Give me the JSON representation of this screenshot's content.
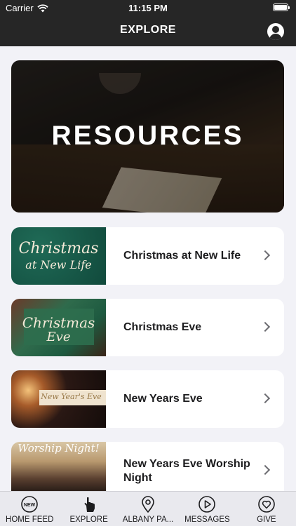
{
  "status_bar": {
    "carrier": "Carrier",
    "time": "11:15 PM"
  },
  "header": {
    "title": "EXPLORE",
    "profile_icon": "person-circle-icon"
  },
  "hero": {
    "label": "RESOURCES"
  },
  "items": [
    {
      "title": "Christmas at New Life",
      "thumb_text_1": "Christmas",
      "thumb_text_2": "at New Life"
    },
    {
      "title": "Christmas Eve",
      "thumb_text_1": "Christmas",
      "thumb_text_2": "Eve"
    },
    {
      "title": "New Years Eve",
      "thumb_text_1": "New Year's Eve"
    },
    {
      "title": "New Years Eve Worship Night",
      "thumb_text_1": "Worship Night!"
    }
  ],
  "tabs": [
    {
      "label": "HOME FEED",
      "icon": "new-badge-icon",
      "icon_text": "NEW"
    },
    {
      "label": "EXPLORE",
      "icon": "hand-pointer-icon"
    },
    {
      "label": "ALBANY PA...",
      "icon": "location-pin-icon"
    },
    {
      "label": "MESSAGES",
      "icon": "play-circle-icon"
    },
    {
      "label": "GIVE",
      "icon": "heart-circle-icon"
    }
  ]
}
